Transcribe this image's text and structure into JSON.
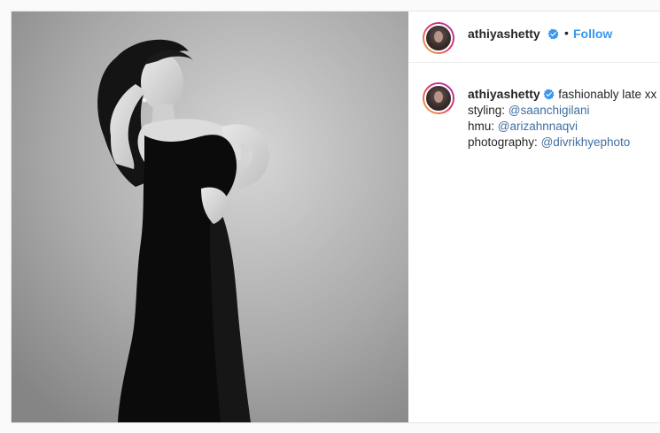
{
  "post": {
    "author": {
      "username": "athiyashetty",
      "verified": true,
      "avatar_icon": "profile-photo-icon"
    },
    "follow_separator": "•",
    "follow_label": "Follow",
    "photo_icon": "portrait-photo",
    "caption": {
      "username": "athiyashetty",
      "text": "fashionably late xx",
      "lines": [
        {
          "label": "styling: ",
          "mention": "@saanchigilani"
        },
        {
          "label": "hmu: ",
          "mention": "@arizahnnaqvi"
        },
        {
          "label": "photography: ",
          "mention": "@divrikhyephoto"
        }
      ]
    }
  },
  "colors": {
    "link": "#3897f0",
    "mention": "#3f6fa3",
    "text": "#262626",
    "verified": "#3897f0"
  }
}
